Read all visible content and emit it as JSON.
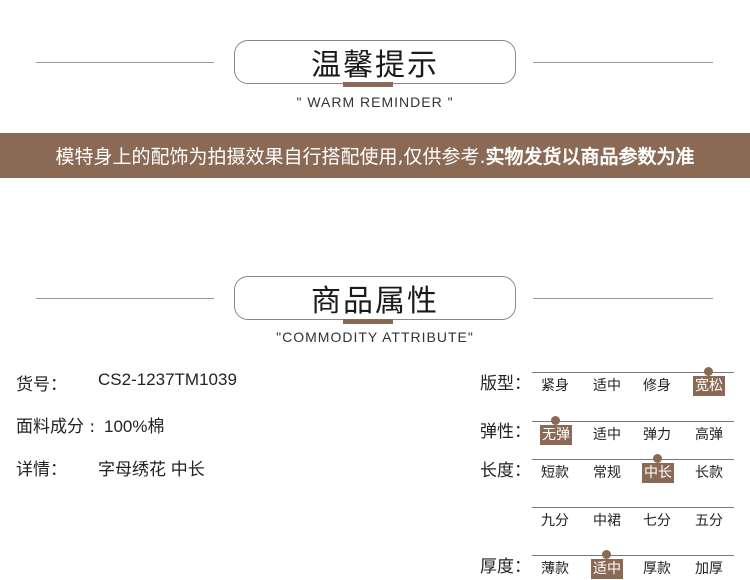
{
  "reminder": {
    "title": "温馨提示",
    "subtitle": "\" WARM REMINDER \"",
    "notice_normal": "模特身上的配饰为拍摄效果自行搭配使用,仅供参考.",
    "notice_bold": "实物发货以商品参数为准"
  },
  "attributes": {
    "title": "商品属性",
    "subtitle": "\"COMMODITY ATTRIBUTE\"",
    "items": [
      {
        "label": "货号：",
        "value": "CS2-1237TM1039"
      },
      {
        "label": "面料成分 : ",
        "value": "100%棉"
      },
      {
        "label": "详情：",
        "value": "字母绣花 中长"
      }
    ]
  },
  "specs": {
    "banxing": {
      "label": "版型：",
      "options": [
        "紧身",
        "适中",
        "修身",
        "宽松"
      ],
      "selected": "宽松"
    },
    "tanxing": {
      "label": "弹性：",
      "options": [
        "无弹",
        "适中",
        "弹力",
        "高弹"
      ],
      "selected": "无弹"
    },
    "changdu": {
      "label": "长度：",
      "options": [
        "短款",
        "常规",
        "中长",
        "长款"
      ],
      "options2": [
        "九分",
        "中裙",
        "七分",
        "五分"
      ],
      "selected": "中长"
    },
    "houdu": {
      "label": "厚度：",
      "options": [
        "薄款",
        "适中",
        "厚款",
        "加厚"
      ],
      "selected": "适中"
    }
  }
}
